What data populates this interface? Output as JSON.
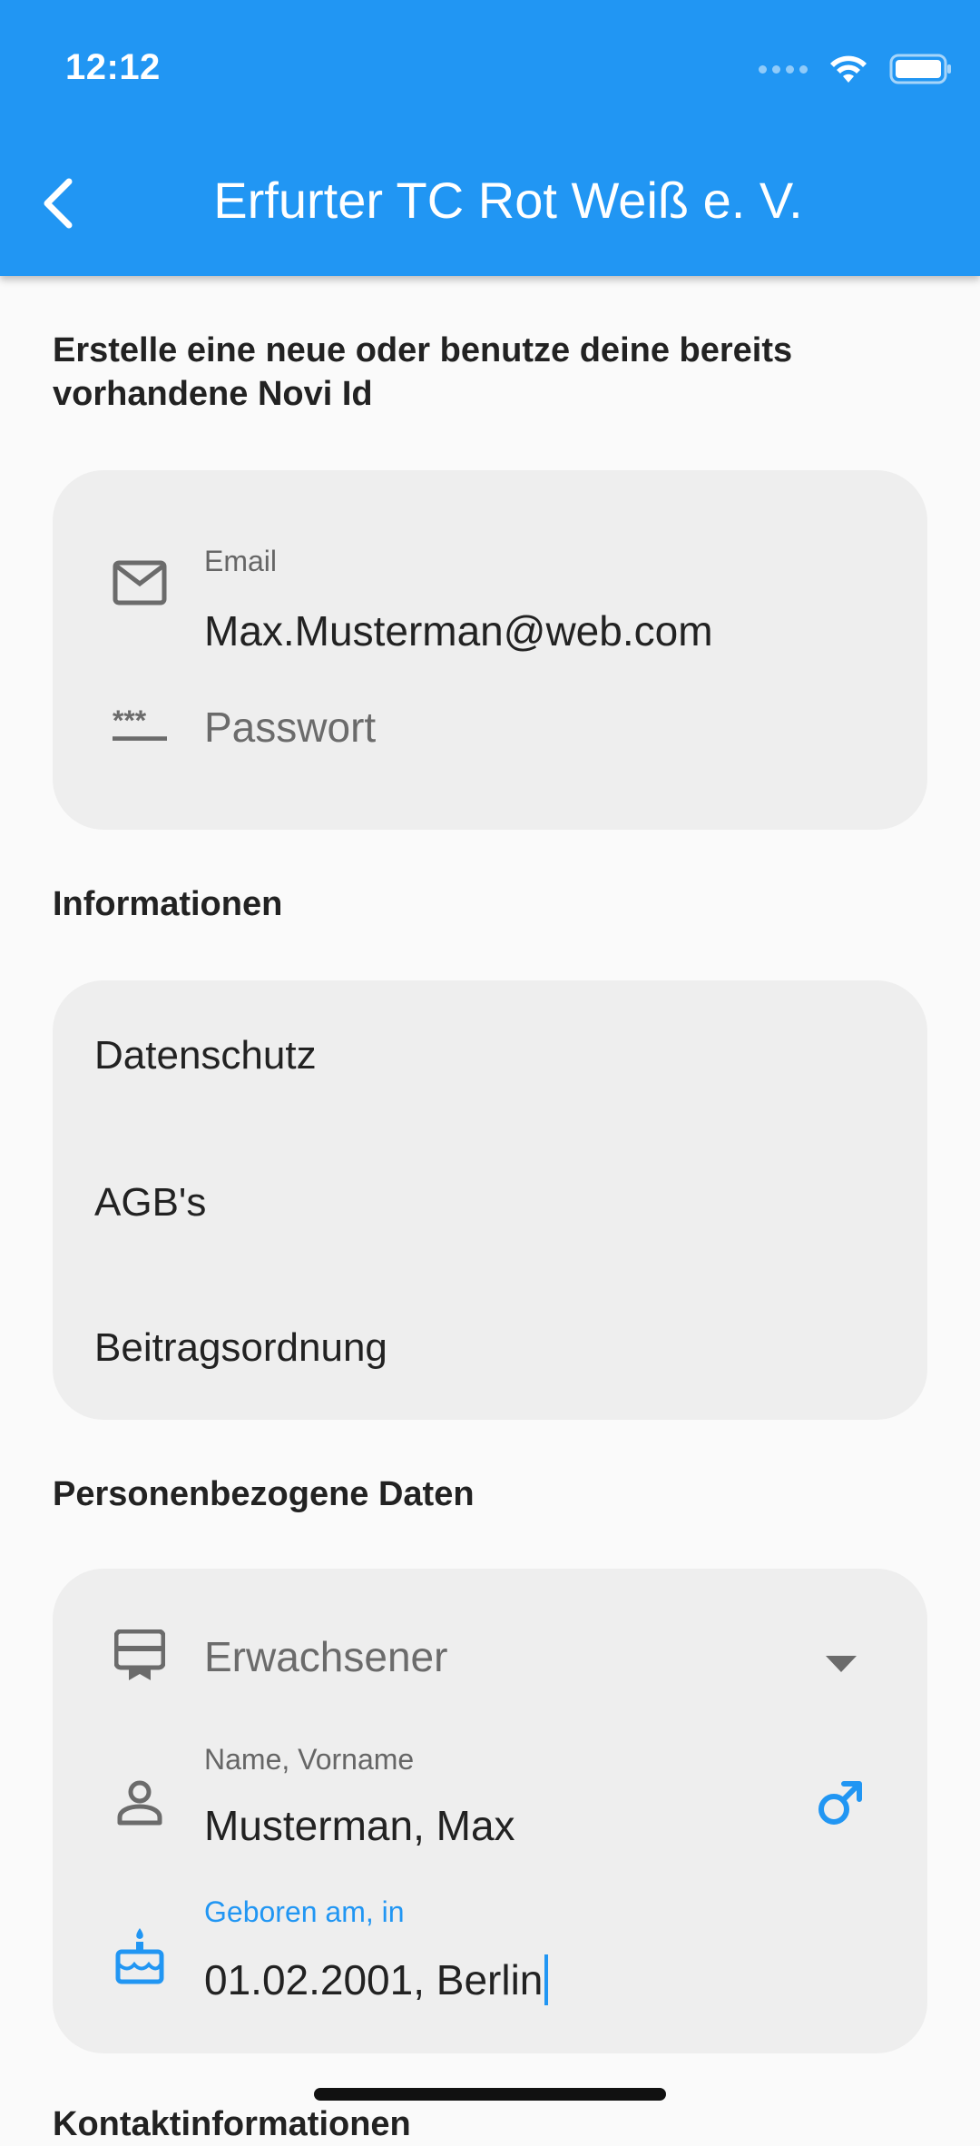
{
  "status_bar": {
    "time": "12:12"
  },
  "app_bar": {
    "title": "Erfurter TC Rot Weiß e. V."
  },
  "novi_section": {
    "heading": "Erstelle eine neue oder benutze deine bereits vorhandene Novi Id",
    "email_label": "Email",
    "email_value": "Max.Musterman@web.com",
    "password_placeholder": "Passwort"
  },
  "info_section": {
    "heading": "Informationen",
    "items": [
      "Datenschutz",
      "AGB's",
      "Beitragsordnung"
    ]
  },
  "personal_section": {
    "heading": "Personenbezogene Daten",
    "membership_type": "Erwachsener",
    "name_label": "Name, Vorname",
    "name_value": "Musterman, Max",
    "birth_label": "Geboren am, in",
    "birth_value": "01.02.2001, Berlin"
  },
  "next_section": {
    "heading": "Kontaktinformationen"
  },
  "colors": {
    "primary": "#2196f3",
    "card_background": "#eeeeee",
    "page_background": "#fafafa",
    "icon_grey": "#6b6b6b"
  },
  "icons": [
    "back-arrow-icon",
    "wifi-icon",
    "battery-icon",
    "mail-icon",
    "password-icon",
    "card-membership-icon",
    "dropdown-arrow-icon",
    "person-icon",
    "male-icon",
    "cake-icon"
  ]
}
